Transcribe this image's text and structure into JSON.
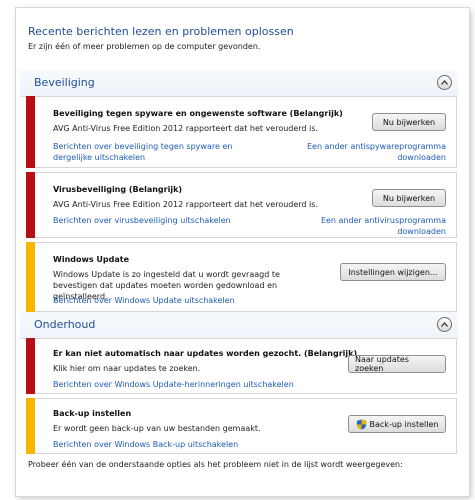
{
  "header": {
    "title": "Recente berichten lezen en problemen oplossen",
    "subtitle": "Er zijn één of meer problemen op de computer gevonden."
  },
  "sections": {
    "security": {
      "label": "Beveiliging",
      "cards": {
        "spyware": {
          "title": "Beveiliging tegen spyware en ongewenste software  (Belangrijk)",
          "description": "AVG Anti-Virus Free Edition 2012 rapporteert dat het verouderd is.",
          "button": "Nu bijwerken",
          "link_left": "Berichten over beveiliging tegen spyware en dergelijke uitschakelen",
          "link_right": "Een ander antispywareprogramma downloaden",
          "severity": "important"
        },
        "virus": {
          "title": "Virusbeveiliging  (Belangrijk)",
          "description": "AVG Anti-Virus Free Edition 2012 rapporteert dat het verouderd is.",
          "button": "Nu bijwerken",
          "link_left": "Berichten over virusbeveiliging uitschakelen",
          "link_right": "Een ander antivirusprogramma downloaden",
          "severity": "important"
        },
        "windows_update": {
          "title": "Windows Update",
          "description": "Windows Update is zo ingesteld dat u wordt gevraagd te bevestigen dat updates moeten worden gedownload en geïnstalleerd.",
          "button": "Instellingen wijzigen...",
          "link_left": "Berichten over Windows Update uitschakelen",
          "severity": "warning"
        }
      }
    },
    "maintenance": {
      "label": "Onderhoud",
      "cards": {
        "update_check": {
          "title": "Er kan niet automatisch naar updates worden gezocht.  (Belangrijk)",
          "description": "Klik hier om naar updates te zoeken.",
          "button": "Naar updates zoeken",
          "link_left": "Berichten over Windows Update-herinneringen uitschakelen",
          "severity": "important"
        },
        "backup": {
          "title": "Back-up instellen",
          "description": "Er wordt geen back-up van uw bestanden gemaakt.",
          "button": "Back-up instellen",
          "link_left": "Berichten over Windows Back-up uitschakelen",
          "severity": "warning"
        }
      }
    }
  },
  "footer": {
    "text": "Probeer één van de onderstaande opties als het probleem niet in de lijst wordt weergegeven:"
  },
  "colors": {
    "important": "#b70f14",
    "warning": "#f7b500",
    "link": "#1d5cb4",
    "heading": "#1e4f94"
  },
  "icons": {
    "collapse": "chevron-up-icon",
    "uac": "uac-shield-icon"
  }
}
